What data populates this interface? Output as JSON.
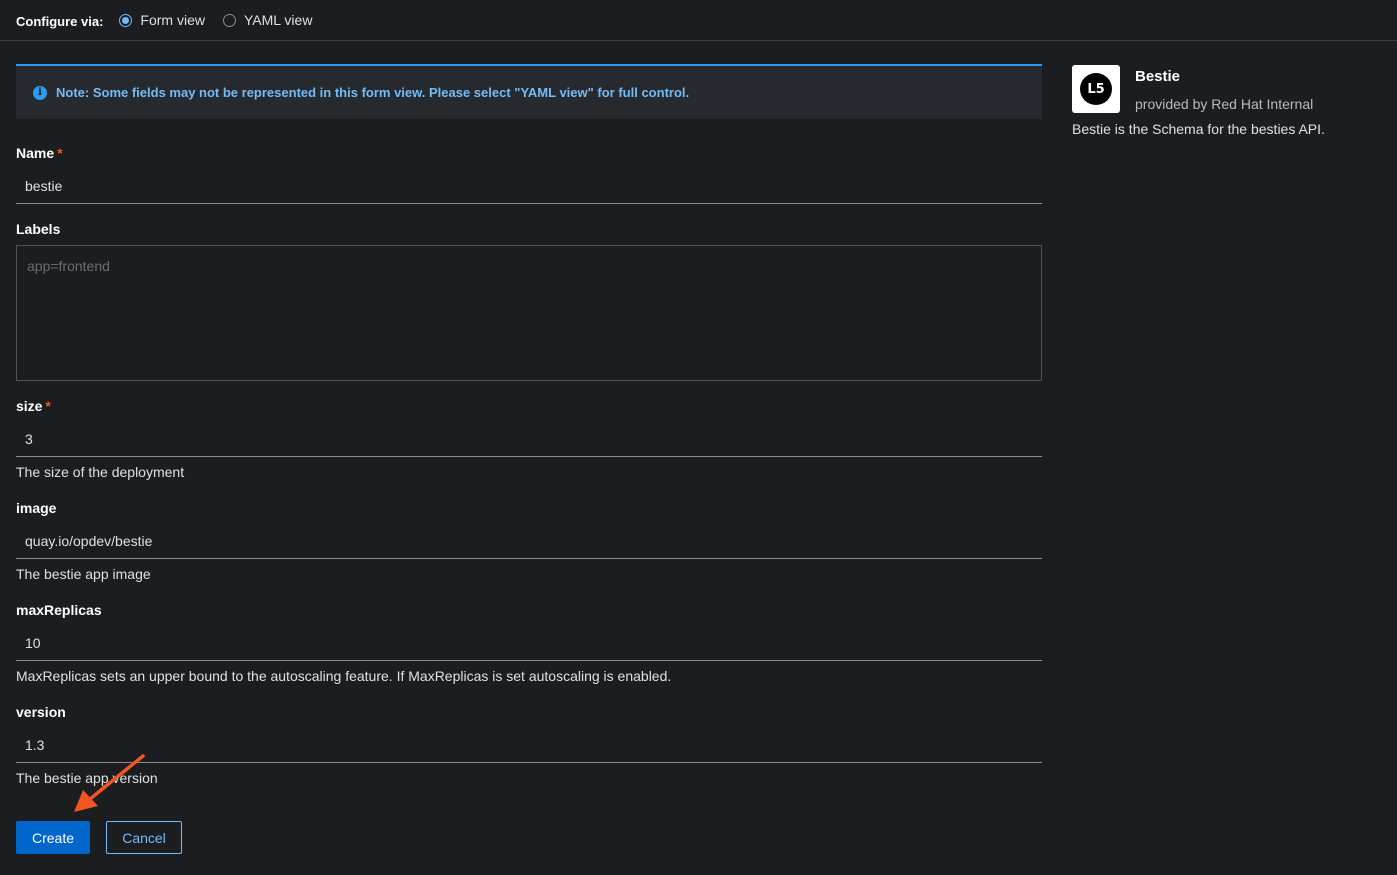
{
  "configure": {
    "label": "Configure via:",
    "options": [
      {
        "label": "Form view",
        "selected": true
      },
      {
        "label": "YAML view",
        "selected": false
      }
    ]
  },
  "alert": {
    "icon": "info-icon",
    "text": "Note: Some fields may not be represented in this form view. Please select \"YAML view\" for full control."
  },
  "form": {
    "name": {
      "label": "Name",
      "required_mark": "*",
      "value": "bestie"
    },
    "labels": {
      "label": "Labels",
      "placeholder": "app=frontend"
    },
    "size": {
      "label": "size",
      "required_mark": "*",
      "value": "3",
      "helper": "The size of the deployment"
    },
    "image": {
      "label": "image",
      "value": "quay.io/opdev/bestie",
      "helper": "The bestie app image"
    },
    "maxReplicas": {
      "label": "maxReplicas",
      "value": "10",
      "helper": "MaxReplicas sets an upper bound to the autoscaling feature. If MaxReplicas is set autoscaling is enabled."
    },
    "version": {
      "label": "version",
      "value": "1.3",
      "helper": "The bestie app version"
    }
  },
  "actions": {
    "create_label": "Create",
    "cancel_label": "Cancel"
  },
  "sidebar": {
    "logo_text": "L5",
    "title": "Bestie",
    "provider": "provided by Red Hat Internal",
    "description": "Bestie is the Schema for the besties API."
  },
  "colors": {
    "background": "#1b1d21",
    "primary": "#0066cc",
    "link": "#73bcf7",
    "required": "#f0561d",
    "annotation_arrow": "#f0561d"
  }
}
